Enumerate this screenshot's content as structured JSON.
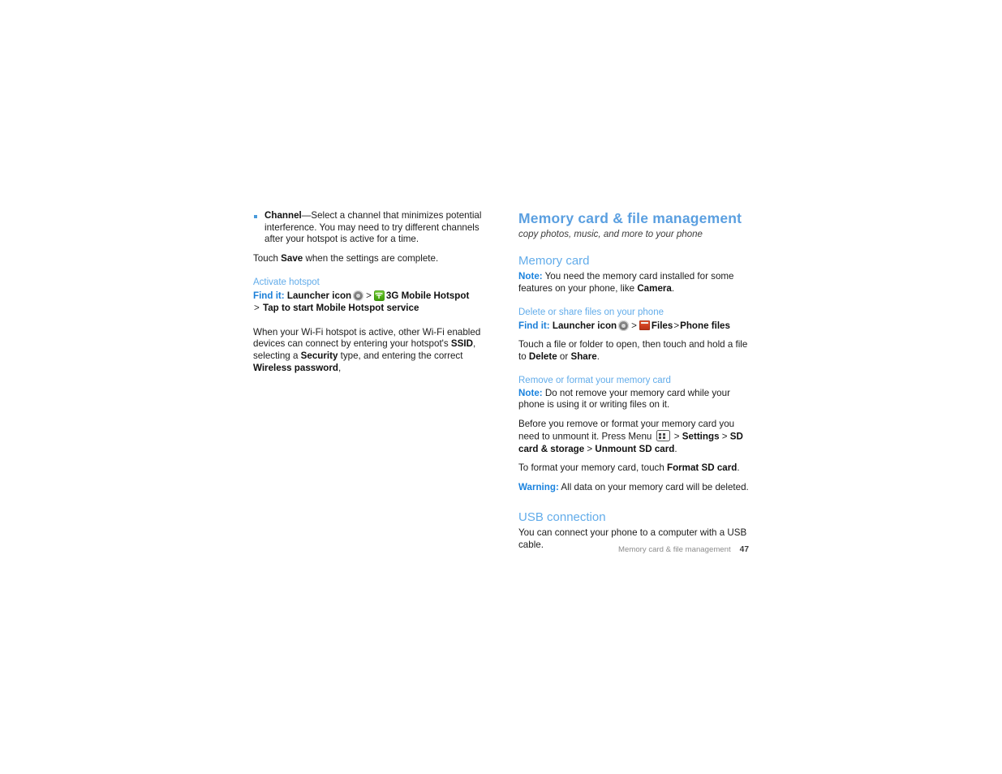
{
  "left_column": {
    "bullets": [
      {
        "term": "Channel",
        "text": "—Select a channel that minimizes potential interference. You may need to try different channels after your hotspot is active for a time."
      }
    ],
    "save_para": {
      "before": "Touch ",
      "bold": "Save",
      "after": " when the settings are complete."
    },
    "activate_heading": "Activate hotspot",
    "find_it_label": "Find it:",
    "path": {
      "step1": "Launcher icon",
      "launcher_icon": "launcher-icon",
      "sep1": ">",
      "hotspot_icon": "3g-hotspot-icon",
      "step2": "3G Mobile Hotspot",
      "sep2": ">",
      "step3": "Tap to start Mobile Hotspot service"
    },
    "wifi_para": {
      "p1": "When your Wi-Fi hotspot is active, other Wi-Fi enabled devices can connect by entering your hotspot's ",
      "b1": "SSID",
      "p2": ", selecting a ",
      "b2": "Security",
      "p3": " type, and entering the correct ",
      "b3": "Wireless password",
      "p4": ","
    }
  },
  "right_column": {
    "chapter_title": "Memory card & file management",
    "chapter_subtitle": "copy photos, music, and more to your phone",
    "section_memory_card": "Memory card",
    "note_label": "Note:",
    "note_memory_card": {
      "p1": " You need the memory card installed for some features on your phone, like ",
      "b1": "Camera",
      "p2": "."
    },
    "subsection_delete_share": "Delete or share files on your phone",
    "find_it_label": "Find it:",
    "path_files": {
      "step1": "Launcher icon",
      "launcher_icon": "launcher-icon",
      "sep1": ">",
      "files_icon": "files-folder-icon",
      "step2": "Files",
      "sep2": ">",
      "step3": "Phone files"
    },
    "touch_file_para": {
      "p1": "Touch a file or folder to open, then touch and hold a file to ",
      "b1": "Delete",
      "p2": " or ",
      "b2": "Share",
      "p3": "."
    },
    "subsection_remove_format": "Remove or format your memory card",
    "note_remove": {
      "p1": " Do not remove your memory card while your phone is using it or writing files on it."
    },
    "unmount_para": {
      "p1": "Before you remove or format your memory card you need to unmount it. Press Menu ",
      "menu_icon": "menu-icon",
      "sep1": " > ",
      "b1": "Settings",
      "sep2": " > ",
      "b2": "SD card & storage",
      "sep3": " > ",
      "b3": "Unmount SD card",
      "p2": "."
    },
    "format_para": {
      "p1": "To format your memory card, touch ",
      "b1": "Format SD card",
      "p2": "."
    },
    "warning_label": "Warning:",
    "warning_para": {
      "p1": " All data on your memory card will be deleted."
    },
    "section_usb": "USB connection",
    "usb_para": "You can connect your phone to a computer with a USB cable."
  },
  "footer": {
    "text": "Memory card & file management",
    "page_number": "47"
  },
  "colors": {
    "chapter_title": "#5a9fe0",
    "section_heading": "#62acea",
    "subsection_heading": "#62acea",
    "find_it": "#1b7fd8",
    "note": "#1b83de",
    "bullet": "#4a9ada",
    "hotspot_icon_green": "#4fb016",
    "files_icon_orange": "#cf3f20"
  }
}
